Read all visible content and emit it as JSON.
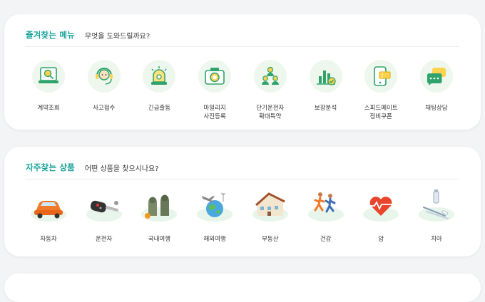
{
  "favorite_menu": {
    "title": "즐겨찾는 메뉴",
    "subtitle": "무엇을 도와드릴까요?",
    "items": [
      {
        "label": "계약조회",
        "icon": "contract-search-icon"
      },
      {
        "label": "사고접수",
        "icon": "headset-agent-icon"
      },
      {
        "label": "긴급출동",
        "icon": "siren-icon"
      },
      {
        "label": "마일리지\n사진등록",
        "icon": "camera-icon"
      },
      {
        "label": "단기운전자\n확대특약",
        "icon": "drivers-group-icon"
      },
      {
        "label": "보장분석",
        "icon": "bar-chart-icon"
      },
      {
        "label": "스피드메이트\n정비쿠폰",
        "icon": "mobile-coupon-icon"
      },
      {
        "label": "채팅상담",
        "icon": "chat-bubble-icon"
      }
    ]
  },
  "products": {
    "title": "자주찾는 상품",
    "subtitle": "어떤 상품을 찾으시나요?",
    "items": [
      {
        "label": "자동차",
        "icon": "car-icon"
      },
      {
        "label": "운전자",
        "icon": "car-key-icon"
      },
      {
        "label": "국내여행",
        "icon": "stone-statue-icon"
      },
      {
        "label": "해외여행",
        "icon": "globe-plane-icon"
      },
      {
        "label": "부동산",
        "icon": "house-icon"
      },
      {
        "label": "건강",
        "icon": "runners-icon"
      },
      {
        "label": "암",
        "icon": "heart-pulse-icon"
      },
      {
        "label": "치아",
        "icon": "toothbrush-icon"
      }
    ]
  },
  "colors": {
    "accent": "#1aa39a",
    "icon_green": "#36b37e",
    "icon_bg": "#eef7ee"
  }
}
